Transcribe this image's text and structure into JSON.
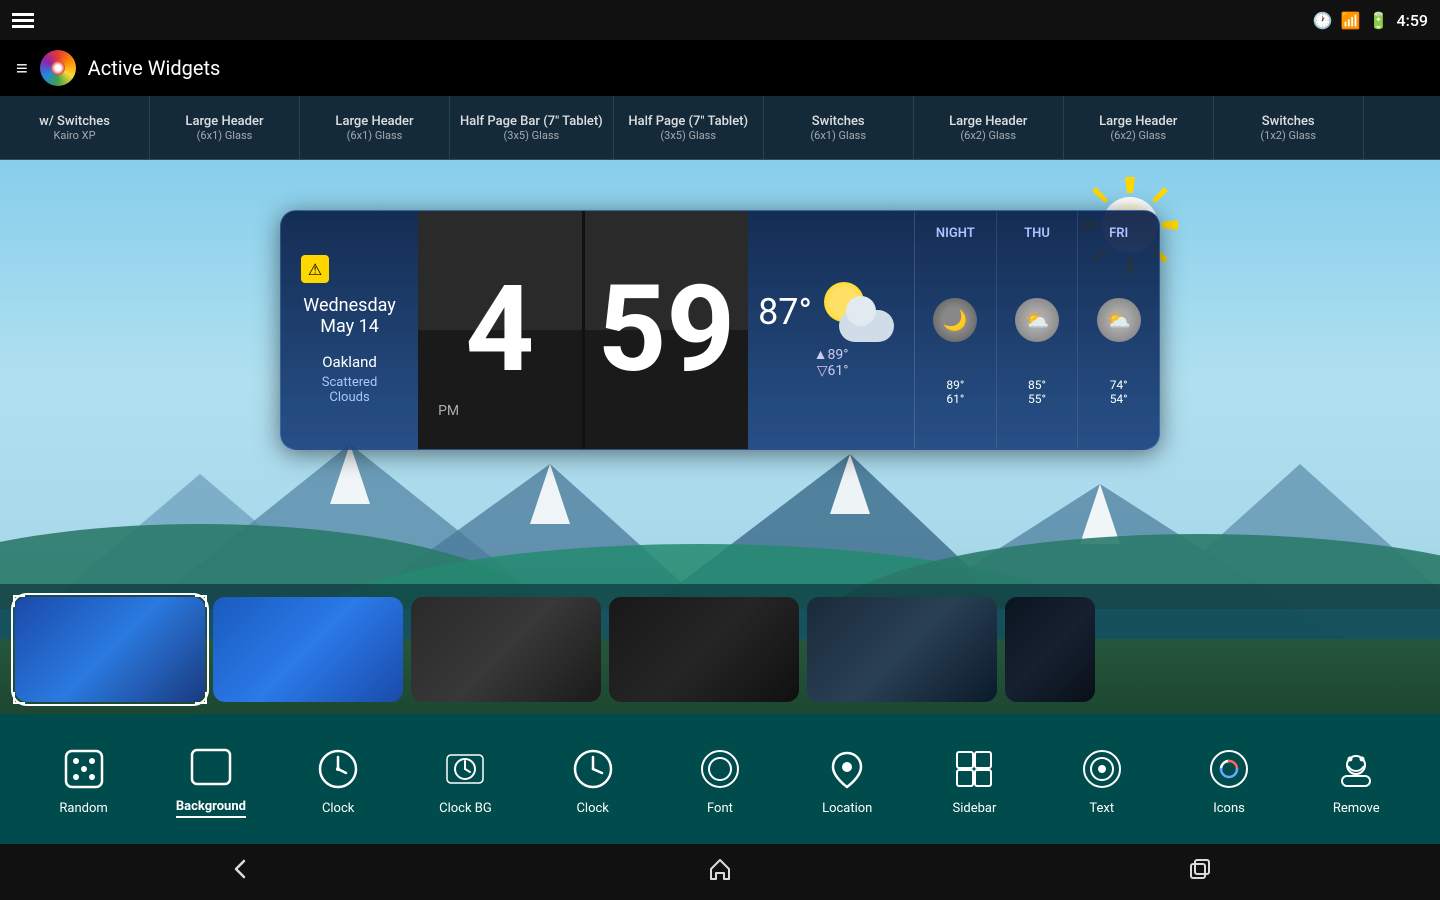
{
  "statusBar": {
    "time": "4:59",
    "icons": [
      "clock-icon",
      "wifi-icon",
      "battery-icon"
    ]
  },
  "appBar": {
    "title": "Active Widgets",
    "menuIcon": "menu-icon"
  },
  "widgetTabs": [
    {
      "name": "w/ Switches",
      "sub": "Kairo XP"
    },
    {
      "name": "Large Header",
      "sub": "(6x1) Glass"
    },
    {
      "name": "Large Header",
      "sub": "(6x1) Glass"
    },
    {
      "name": "Half Page Bar (7\" Tablet)",
      "sub": "(3x5) Glass"
    },
    {
      "name": "Half Page (7\" Tablet)",
      "sub": "(3x5) Glass"
    },
    {
      "name": "Switches",
      "sub": "(6x1) Glass"
    },
    {
      "name": "Large Header",
      "sub": "(6x2) Glass"
    },
    {
      "name": "Large Header",
      "sub": "(6x2) Glass"
    },
    {
      "name": "Switches",
      "sub": "(1x2) Glass"
    }
  ],
  "weatherWidget": {
    "date": "Wednesday\nMay 14",
    "city": "Oakland",
    "description": "Scattered Clouds",
    "time": {
      "hour": "4",
      "minute": "59",
      "period": "PM"
    },
    "current": {
      "temp": "87°",
      "hiTemp": "▲89°",
      "loTemp": "▽61°"
    },
    "forecast": [
      {
        "day": "NIGHT",
        "high": "89°",
        "low": "61°",
        "icon": "🌙"
      },
      {
        "day": "THU",
        "high": "85°",
        "low": "55°",
        "icon": "⛅"
      },
      {
        "day": "FRI",
        "high": "74°",
        "low": "54°",
        "icon": "⛅"
      }
    ]
  },
  "toolbar": {
    "items": [
      {
        "id": "random",
        "label": "Random",
        "icon": "🎲"
      },
      {
        "id": "background",
        "label": "Background",
        "icon": "▭",
        "active": true
      },
      {
        "id": "clock",
        "label": "Clock",
        "icon": "🕐"
      },
      {
        "id": "clock-bg",
        "label": "Clock BG",
        "icon": "🕐"
      },
      {
        "id": "clock2",
        "label": "Clock",
        "icon": "🕐"
      },
      {
        "id": "font",
        "label": "Font",
        "icon": "🔤"
      },
      {
        "id": "location",
        "label": "Location",
        "icon": "📍"
      },
      {
        "id": "sidebar",
        "label": "Sidebar",
        "icon": "⊞"
      },
      {
        "id": "text",
        "label": "Text",
        "icon": "🎨"
      },
      {
        "id": "icons",
        "label": "Icons",
        "icon": "🎨"
      },
      {
        "id": "remove",
        "label": "Remove",
        "icon": "👻"
      }
    ]
  },
  "navBar": {
    "back": "←",
    "home": "⌂",
    "recents": "⬜"
  },
  "skins": [
    {
      "id": "skin-1",
      "color1": "#1a3a8a",
      "color2": "#2a5ac0",
      "selected": true
    },
    {
      "id": "skin-2",
      "color1": "#1a4aaa",
      "color2": "#2a6ae0"
    },
    {
      "id": "skin-3",
      "color1": "#2a2a2a",
      "color2": "#3a3a3a"
    },
    {
      "id": "skin-4",
      "color1": "#1a1a1a",
      "color2": "#2a2a2a"
    },
    {
      "id": "skin-5",
      "color1": "#1a2a3a",
      "color2": "#2a4a5a"
    },
    {
      "id": "skin-6",
      "color1": "#0a1a2a",
      "color2": "#1a2a3a"
    }
  ]
}
